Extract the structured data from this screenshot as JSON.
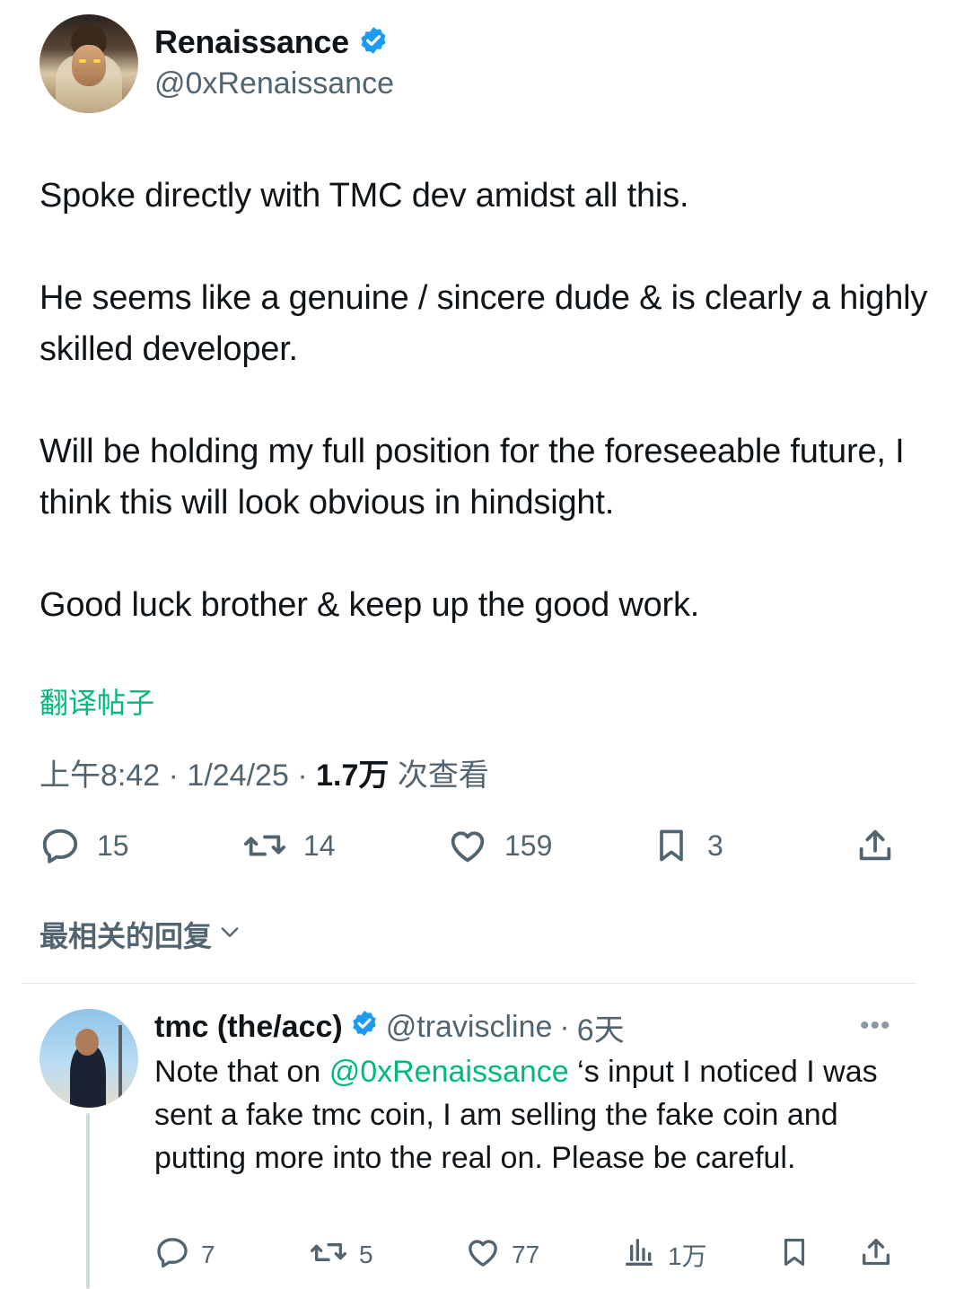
{
  "author": {
    "name": "Renaissance",
    "handle": "@0xRenaissance",
    "verified": true
  },
  "tweet": {
    "paragraphs": [
      "Spoke directly with TMC dev amidst all this.",
      "He seems like a genuine / sincere dude & is clearly a highly skilled developer.",
      "Will be holding my full position for the foreseeable future, I think this will look obvious in hindsight.",
      "Good luck brother & keep up the good work."
    ],
    "translate_label": "翻译帖子",
    "time": "上午8:42",
    "date": "1/24/25",
    "views_count": "1.7万",
    "views_label": "次查看",
    "sep": "·"
  },
  "actions": {
    "replies": "15",
    "reposts": "14",
    "likes": "159",
    "bookmarks": "3"
  },
  "sort_label": "最相关的回复",
  "reply": {
    "name": "tmc (the/acc)",
    "handle": "@traviscline",
    "sep": "·",
    "age": "6天",
    "more": "•••",
    "text_before": "Note that on ",
    "mention": "@0xRenaissance",
    "text_after": " ‘s input I noticed I was sent a fake tmc coin, I am selling the fake coin and putting more into the real on. Please be careful.",
    "actions": {
      "replies": "7",
      "reposts": "5",
      "likes": "77",
      "views": "1万"
    }
  },
  "colors": {
    "verified": "#1d9bf0",
    "accent_green": "#00ba7c",
    "muted": "#536471",
    "text": "#0f1419"
  }
}
